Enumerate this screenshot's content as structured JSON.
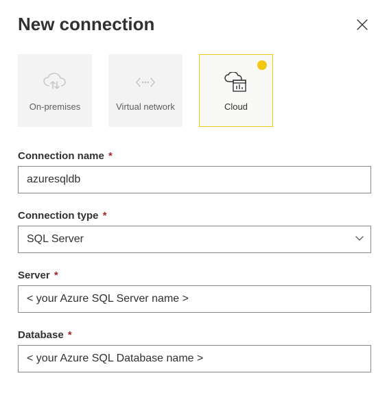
{
  "title": "New connection",
  "tabs": [
    {
      "label": "On-premises",
      "icon": "cloud-sync-icon",
      "selected": false
    },
    {
      "label": "Virtual network",
      "icon": "vnet-icon",
      "selected": false
    },
    {
      "label": "Cloud",
      "icon": "cloud-db-icon",
      "selected": true
    }
  ],
  "fields": {
    "connection_name": {
      "label": "Connection name",
      "required_marker": "*",
      "value": "azuresqldb"
    },
    "connection_type": {
      "label": "Connection type",
      "required_marker": "*",
      "value": "SQL Server"
    },
    "server": {
      "label": "Server",
      "required_marker": "*",
      "value": "< your Azure SQL Server name >"
    },
    "database": {
      "label": "Database",
      "required_marker": "*",
      "value": "< your Azure SQL Database name >"
    }
  },
  "colors": {
    "accent": "#f2c811",
    "required": "#a4262c"
  }
}
